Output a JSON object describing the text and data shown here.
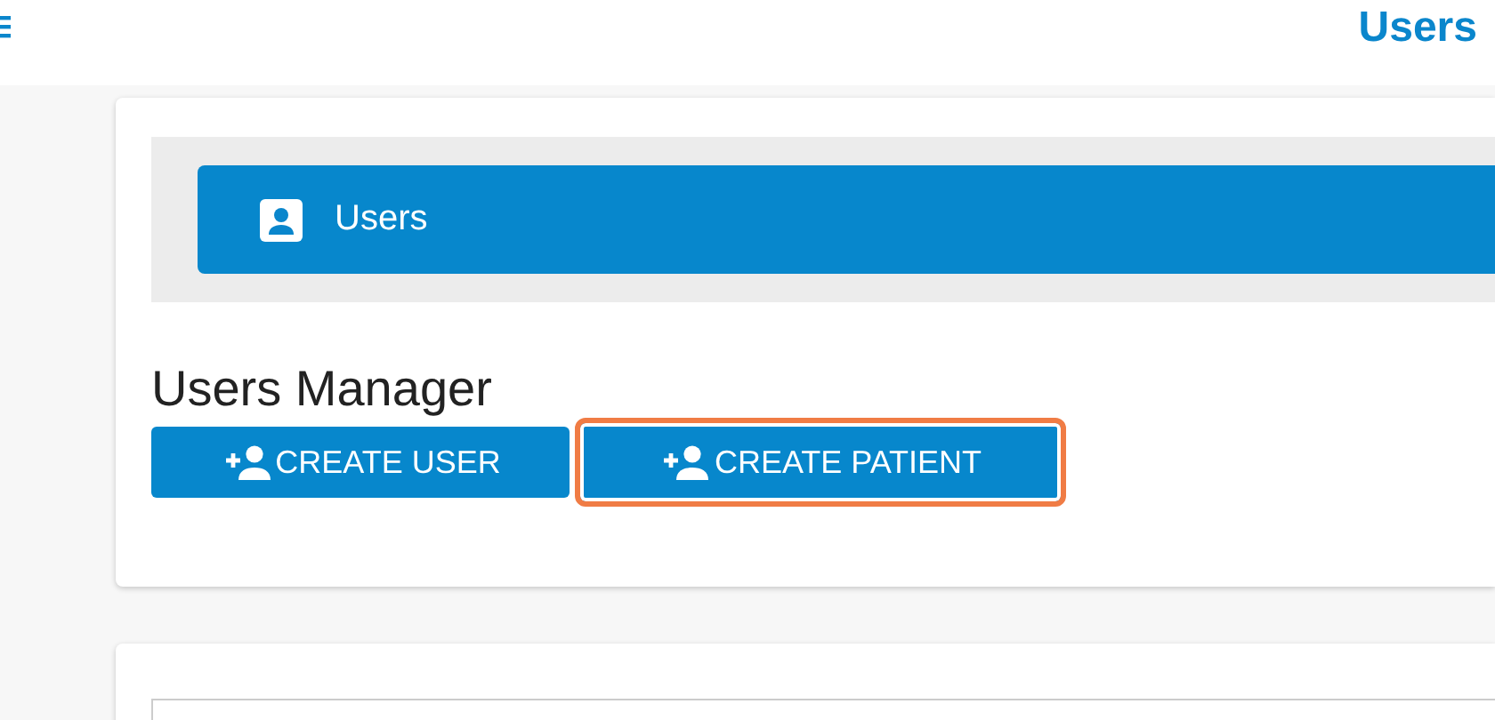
{
  "header": {
    "title": "Users"
  },
  "banner": {
    "label": "Users"
  },
  "manager": {
    "heading": "Users Manager",
    "buttons": [
      {
        "label": "CREATE USER",
        "highlighted": false
      },
      {
        "label": "CREATE PATIENT",
        "highlighted": true
      }
    ]
  }
}
